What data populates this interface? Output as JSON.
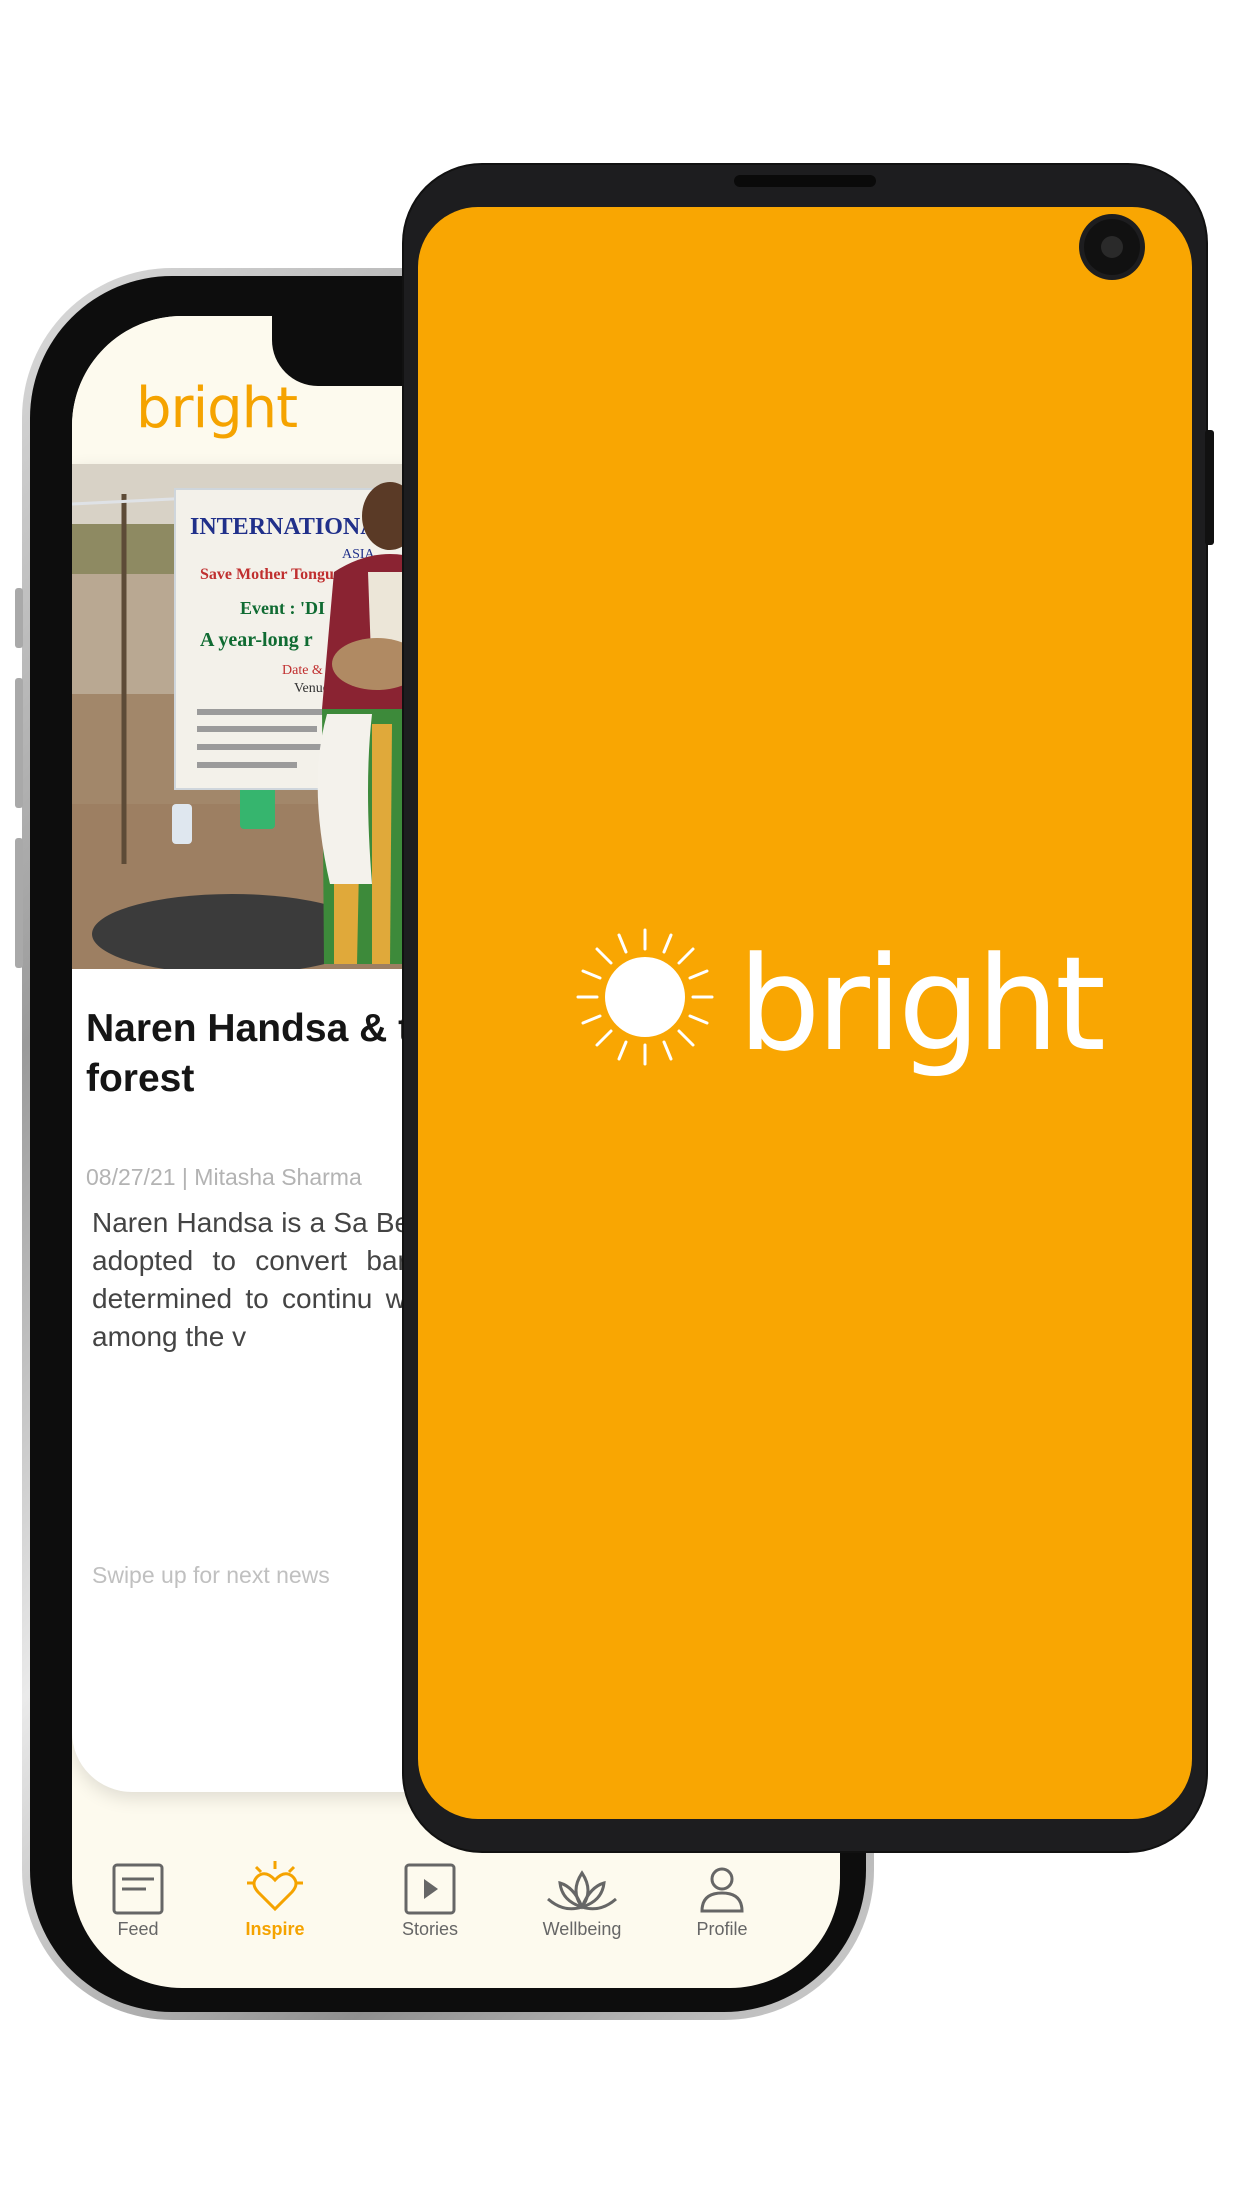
{
  "back_phone": {
    "app_logo": "bright",
    "article": {
      "headline": "Naren Handsa & turning 40 acres mini forest",
      "date": "08/27/21",
      "author": "Mitasha Sharma",
      "body": "Naren Handsa is a Sa Bengal, who offers free children, has adopted to convert barren lanc his NGO Sido Kanhu determined to continu wants to further focus c education among the v",
      "photo_banner_lines": [
        "INTERNATIONAL YEAR O",
        "ASIA",
        "Save Mother Tongue",
        "Event : 'DI",
        "A year-long r",
        "Date & Tim",
        "Venue"
      ]
    },
    "swipe_hint": "Swipe up for next news",
    "nav": [
      {
        "label": "Feed",
        "icon": "feed-icon",
        "active": false
      },
      {
        "label": "Inspire",
        "icon": "heart-sun-icon",
        "active": true
      },
      {
        "label": "Stories",
        "icon": "play-icon",
        "active": false
      },
      {
        "label": "Wellbeing",
        "icon": "lotus-icon",
        "active": false
      },
      {
        "label": "Profile",
        "icon": "profile-icon",
        "active": false
      }
    ],
    "accent_color": "#f5a300"
  },
  "front_phone": {
    "splash_wordmark": "bright",
    "splash_background": "#f9a602"
  }
}
